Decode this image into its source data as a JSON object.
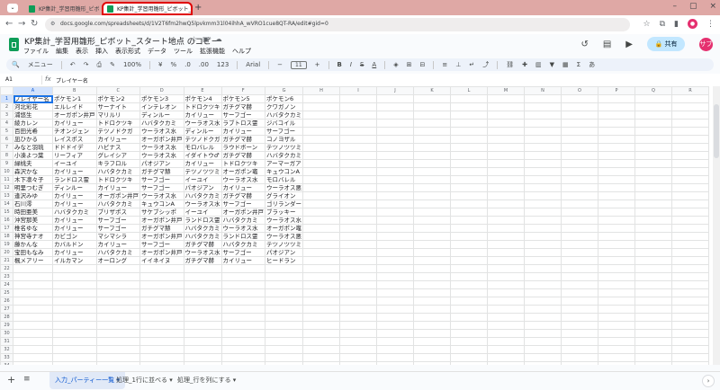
{
  "browser": {
    "tabs": [
      {
        "title": "KP集計_学習用雛形_ピボット_スタ"
      },
      {
        "title": "KP集計_学習用雛形_ピボット_スタ"
      }
    ],
    "url": "docs.google.com/spreadsheets/d/1V2T6fm2hwQ5lpvkmm31l04ihhA_wVRO1cue8QT-RA/edit#gid=0"
  },
  "sheets": {
    "doc_title": "KP集計_学習用雛形_ピボット_スタート地点 のコピー",
    "menu": [
      "ファイル",
      "編集",
      "表示",
      "挿入",
      "表示形式",
      "データ",
      "ツール",
      "拡張機能",
      "ヘルプ"
    ],
    "share_label": "共有",
    "avatar_text": "サブ",
    "toolbar": {
      "menu_search": "メニュー",
      "zoom": "100%",
      "currency": "¥",
      "percent": "%",
      "decimal_dec": ".0",
      "decimal_inc": ".00",
      "number_format": "123",
      "font": "Arial",
      "font_size": "11",
      "bold": "B",
      "italic": "I",
      "strike": "S",
      "text_color": "A",
      "more": "あ"
    },
    "formula_bar": {
      "cell_ref": "A1",
      "fx": "fx",
      "value": "プレイヤー名"
    },
    "columns": [
      "A",
      "B",
      "C",
      "D",
      "E",
      "F",
      "G",
      "H",
      "I",
      "J",
      "K",
      "L",
      "M",
      "N",
      "O",
      "P",
      "Q",
      "R"
    ],
    "rows": [
      [
        "プレイヤー名",
        "ポケモン1",
        "ポケモン2",
        "ポケモン3",
        "ポケモン4",
        "ポケモン5",
        "ポケモン6"
      ],
      [
        "河北彩花",
        "エルレイド",
        "サーナイト",
        "インテレオン",
        "トドロクツキ",
        "ガチグマ赫",
        "クワガノン"
      ],
      [
        "浦悠生",
        "オーガポン井戸",
        "マリルリ",
        "ディンルー",
        "カイリュー",
        "サーフゴー",
        "ハバタクカミ"
      ],
      [
        "綾カレン",
        "カイリュー",
        "トドロクツキ",
        "ハバタクカミ",
        "ウーラオス水",
        "ラブトロス霊",
        "ジバコイル"
      ],
      [
        "百田光希",
        "チオンジェン",
        "テツノドクガ",
        "ウーラオス水",
        "ディンルー",
        "カイリュー",
        "サーフゴー"
      ],
      [
        "凪ひかる",
        "レイスポス",
        "カイリュー",
        "オーガポン井戸",
        "テツノドクガ",
        "ガチグマ赫",
        "コノヨザル"
      ],
      [
        "みなと羽琉",
        "ドドドイデ",
        "ハピナス",
        "ウーラオス水",
        "モロバレル",
        "ラウドボーン",
        "テツノツツミ"
      ],
      [
        "小湊よつ葉",
        "リーフィア",
        "グレイシア",
        "ウーラオス水",
        "イダイトウ♂",
        "ガチグマ赫",
        "ハバタクカミ"
      ],
      [
        "緑桃夫",
        "イーユイ",
        "キラフロル",
        "パオジアン",
        "カイリュー",
        "トドロクツキ",
        "アーマーガア"
      ],
      [
        "森沢かな",
        "カイリュー",
        "ハバタクカミ",
        "ガチグマ赫",
        "テツノツツミ",
        "オーガポン竈",
        "キュウコンA"
      ],
      [
        "木下凛々子",
        "ランドロス霊",
        "トドロクツキ",
        "サーフゴー",
        "イーユイ",
        "ウーラオス水",
        "モロバレル"
      ],
      [
        "明里つむぎ",
        "ディンルー",
        "カイリュー",
        "サーフゴー",
        "パオジアン",
        "カイリュー",
        "ウーラオス悪"
      ],
      [
        "逢沢みゆ",
        "カイリュー",
        "オーガポン井戸",
        "ウーラオス水",
        "ハバタクカミ",
        "ガチグマ赫",
        "グライオン"
      ],
      [
        "石川澪",
        "カイリュー",
        "ハバタクカミ",
        "キュウコンA",
        "ウーラオス水",
        "サーフゴー",
        "ゴリランダー"
      ],
      [
        "時田亜美",
        "ハバタクカミ",
        "ブリザポス",
        "サケブシッポ",
        "イーユイ",
        "オーガポン井戸",
        "ブラッキー"
      ],
      [
        "沖宮那美",
        "カイリュー",
        "サーフゴー",
        "オーガポン井戸",
        "ランドロス霊",
        "ハバタクカミ",
        "ウーラオス水"
      ],
      [
        "椎名ゆな",
        "カイリュー",
        "サーフゴー",
        "ガチグマ赫",
        "ハバタクカミ",
        "ウーラオス水",
        "オーガポン竈"
      ],
      [
        "神宮寺ナオ",
        "カビゴン",
        "マシマシラ",
        "オーガポン井戸",
        "ハバタクカミ",
        "ランドロス霊",
        "ウーラオス悪"
      ],
      [
        "藤かんな",
        "カバルドン",
        "カイリュー",
        "サーフゴー",
        "ガチグマ赫",
        "ハバタクカミ",
        "テツノツツミ"
      ],
      [
        "宝田もなみ",
        "カイリュー",
        "ハバタクカミ",
        "オーガポン井戸",
        "ウーラオス水",
        "サーフゴー",
        "パオジアン"
      ],
      [
        "楓メアリー",
        "イルカマン",
        "オーロング",
        "イイネイヌ",
        "ガチグマ赫",
        "カイリュー",
        "ヒードラン"
      ]
    ],
    "row_count": 35,
    "sheet_tabs": [
      "入力_パーティー一覧",
      "処理_1行に並べる",
      "処理_行を列にする"
    ]
  },
  "colors": {
    "tabstrip": "#dfa8a5",
    "active_tab_outline": "#e00000",
    "selection": "#1a73e8",
    "sheets_green": "#0f9d58"
  }
}
